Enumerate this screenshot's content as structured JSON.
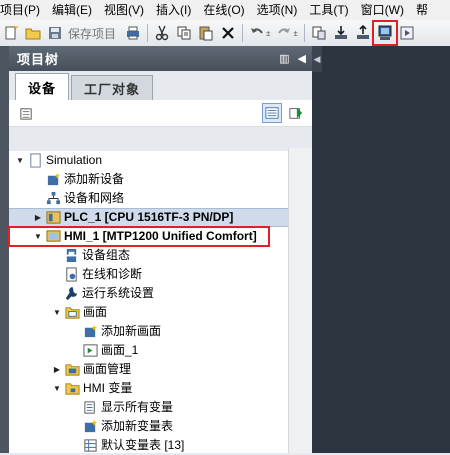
{
  "menu": [
    "项目(P)",
    "编辑(E)",
    "视图(V)",
    "插入(I)",
    "在线(O)",
    "选项(N)",
    "工具(T)",
    "窗口(W)",
    "帮"
  ],
  "toolbar": {
    "save_project_label": "保存项目"
  },
  "panel": {
    "title": "项目树",
    "tabs": [
      "设备",
      "工厂对象"
    ]
  },
  "tree": {
    "root": "Simulation",
    "add_device": "添加新设备",
    "devices_networks": "设备和网络",
    "plc": "PLC_1 [CPU 1516TF-3 PN/DP]",
    "hmi": "HMI_1 [MTP1200 Unified Comfort]",
    "device_config": "设备组态",
    "online_diag": "在线和诊断",
    "runtime_settings": "运行系统设置",
    "screens": "画面",
    "add_screen": "添加新画面",
    "screen_1": "画面_1",
    "screen_mgmt": "画面管理",
    "hmi_tags": "HMI 变量",
    "show_all_tags": "显示所有变量",
    "add_tag_table": "添加新变量表",
    "default_tag_table": "默认变量表 [13]"
  },
  "colors": {
    "highlight": "#e21e26",
    "panel_header": "#4f5965",
    "workarea": "#2d3540"
  }
}
